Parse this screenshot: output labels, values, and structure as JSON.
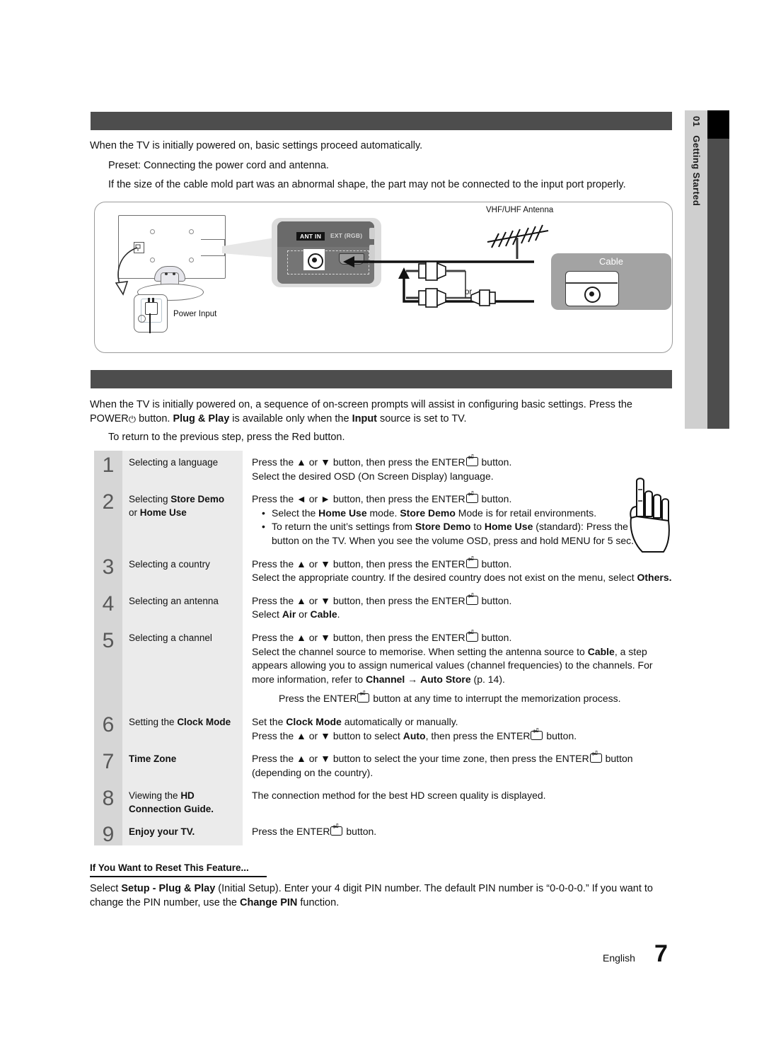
{
  "sidebar": {
    "number": "01",
    "label": "Getting Started"
  },
  "section1": {
    "bar_title": "",
    "paragraphs": [
      "When the TV is initially powered on, basic settings proceed automatically.",
      "Preset: Connecting the power cord and antenna.",
      "If the size of the cable mold part was an abnormal shape, the part may not be connected to the input port properly."
    ]
  },
  "diagram": {
    "labels": {
      "vhf_uhf_antenna": "VHF/UHF Antenna",
      "cable": "Cable",
      "or": "or",
      "power_input": "Power Input",
      "ant_in": "ANT IN",
      "ext_rgb": "EXT (RGB)"
    }
  },
  "section2": {
    "bar_title": "",
    "paragraph_lines": [
      "When the TV is initially powered on, a sequence of on-screen prompts will assist in configuring basic settings. Press the",
      "POWER",
      "button.",
      "Plug & Play",
      "is available only when the",
      "Input",
      "source is set to TV."
    ],
    "sub_note": "To return to the previous step, press the Red button."
  },
  "steps": [
    {
      "number": "1",
      "title_plain": "Selecting a language",
      "lines": [
        "Press the ▲ or ▼ button, then press the ENTER",
        "button.",
        "Select the desired OSD (On Screen Display) language."
      ]
    },
    {
      "number": "2",
      "title_pre": "Selecting ",
      "title_bold1": "Store Demo",
      "title_mid": "or ",
      "title_bold2": "Home Use",
      "lead": "Press the ◄ or ► button, then press the ENTER",
      "lead_tail": "button.",
      "bullets": [
        "Select the Home Use mode. Store Demo Mode is for retail environments.",
        "To return the unit’s settings from Store Demo to Home Use (standard): Press the volume button on the TV. When you see the volume OSD, press and hold MENU for 5 sec."
      ]
    },
    {
      "number": "3",
      "title_plain": "Selecting a country",
      "lines": [
        "Press the ▲ or ▼ button, then press the ENTER",
        "button.",
        "Select the appropriate country. If the desired country does not exist on the menu, select",
        "Others."
      ]
    },
    {
      "number": "4",
      "title_plain": "Selecting an antenna",
      "lines": [
        "Press the ▲ or ▼ button, then press the ENTER",
        "button.",
        "Select Air or Cable."
      ]
    },
    {
      "number": "5",
      "title_plain": "Selecting a channel",
      "lines": [
        "Press the ▲ or ▼ button, then press the ENTER",
        "button.",
        "Select the channel source to memorise. When setting the antenna source to Cable, a step appears allowing you to assign numerical values (channel frequencies) to the channels. For more information, refer to Channel → Auto Store (p. 14).",
        "Press the ENTER button at any time to interrupt the memorization process."
      ]
    },
    {
      "number": "6",
      "title_plain": "Setting the Clock Mode",
      "lines": [
        "Set the Clock Mode automatically or manually.",
        "Press the ▲ or ▼ button to select Auto, then press the ENTER",
        "button."
      ]
    },
    {
      "number": "7",
      "title_plain": "Time Zone",
      "lines": [
        "Press the ▲ or ▼ button to select the your time zone, then press the ENTER",
        "button",
        "(depending on the country)."
      ]
    },
    {
      "number": "8",
      "title_plain": "Viewing the HD Connection Guide.",
      "lines": [
        "The connection method for the best HD screen quality is displayed."
      ]
    },
    {
      "number": "9",
      "title_plain": "Enjoy your TV.",
      "lines": [
        "Press the ENTER",
        "button."
      ]
    }
  ],
  "reset": {
    "heading": "If You Want to Reset This Feature...",
    "line1_a": "Select ",
    "line1_b": "Setup - Plug & Play",
    "line1_c": " (Initial Setup). Enter your 4 digit PIN number. The default PIN number is “0-0-0-0.” If you want to",
    "line2_a": "change the PIN number, use the ",
    "line2_b": "Change PIN",
    "line2_c": " function."
  },
  "footer": {
    "language": "English",
    "page_number": "7"
  },
  "colors": {
    "bar": "#4d4d4d",
    "sidebar": "#cfcfcf",
    "step_num_bg": "#d6d6d6",
    "step_title_bg": "#ebebeb"
  }
}
